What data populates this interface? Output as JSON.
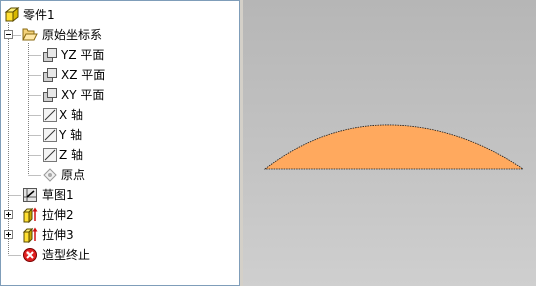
{
  "tree": {
    "root": {
      "label": "零件1",
      "icon": "part-cube-icon"
    },
    "origin": {
      "label": "原始坐标系",
      "icon": "folder-open-icon",
      "children": [
        {
          "label": "YZ 平面",
          "icon": "plane-icon"
        },
        {
          "label": "XZ 平面",
          "icon": "plane-icon"
        },
        {
          "label": "XY 平面",
          "icon": "plane-icon"
        },
        {
          "label": "X 轴",
          "icon": "axis-icon"
        },
        {
          "label": "Y 轴",
          "icon": "axis-icon"
        },
        {
          "label": "Z 轴",
          "icon": "axis-icon"
        },
        {
          "label": "原点",
          "icon": "origin-point-icon"
        }
      ]
    },
    "sketch": {
      "label": "草图1",
      "icon": "sketch-icon"
    },
    "extrude2": {
      "label": "拉伸2",
      "icon": "extrude-icon"
    },
    "extrude3": {
      "label": "拉伸3",
      "icon": "extrude-icon"
    },
    "end": {
      "label": "造型终止",
      "icon": "end-of-part-icon"
    }
  },
  "colors": {
    "shape_fill": "#ffa95e",
    "tree_bg": "#ffffff",
    "viewport_bg": "#c0c0c0",
    "end_icon": "#e02020"
  }
}
